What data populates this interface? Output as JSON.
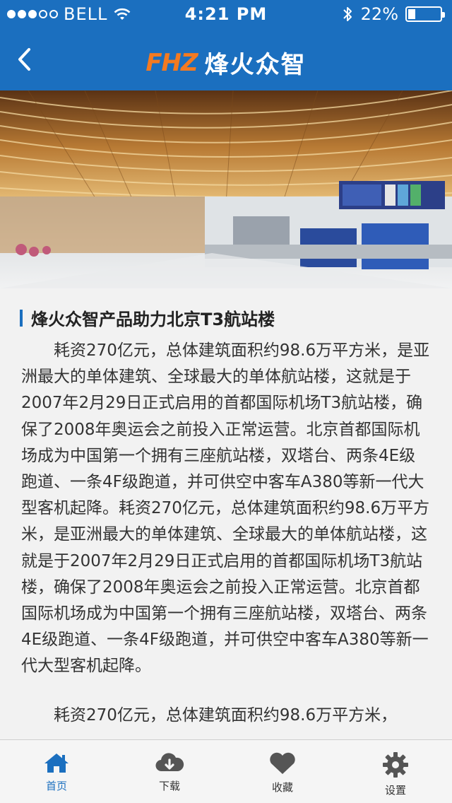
{
  "status_bar": {
    "carrier": "BELL",
    "time": "4:21 PM",
    "battery": "22%",
    "battery_level": 0.22
  },
  "header": {
    "logo_mark": "FHZ",
    "logo_name": "烽火众智"
  },
  "article": {
    "title": "烽火众智产品助力北京T3航站楼",
    "paragraphs": [
      "耗资270亿元，总体建筑面积约98.6万平方米，是亚洲最大的单体建筑、全球最大的单体航站楼，这就是于2007年2月29日正式启用的首都国际机场T3航站楼，确保了2008年奥运会之前投入正常运营。北京首都国际机场成为中国第一个拥有三座航站楼，双塔台、两条4E级跑道、一条4F级跑道，并可供空中客车A380等新一代大型客机起降。耗资270亿元，总体建筑面积约98.6万平方米，是亚洲最大的单体建筑、全球最大的单体航站楼，这就是于2007年2月29日正式启用的首都国际机场T3航站楼，确保了2008年奥运会之前投入正常运营。北京首都国际机场成为中国第一个拥有三座航站楼，双塔台、两条4E级跑道、一条4F级跑道，并可供空中客车A380等新一代大型客机起降。",
      "耗资270亿元，总体建筑面积约98.6万平方米，"
    ]
  },
  "tabbar": {
    "items": [
      {
        "label": "首页",
        "icon": "home-icon",
        "active": true
      },
      {
        "label": "下载",
        "icon": "cloud-download-icon",
        "active": false
      },
      {
        "label": "收藏",
        "icon": "heart-icon",
        "active": false
      },
      {
        "label": "设置",
        "icon": "gear-icon",
        "active": false
      }
    ]
  },
  "colors": {
    "brand_blue": "#1b6fbf",
    "logo_orange": "#f47a20",
    "tab_inactive": "#555555"
  }
}
